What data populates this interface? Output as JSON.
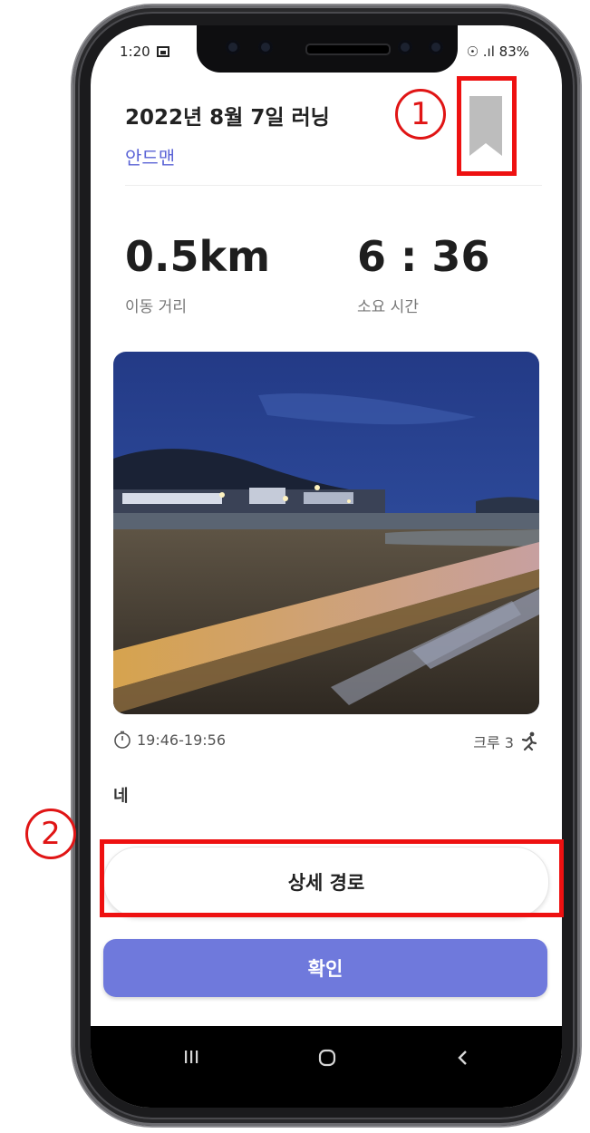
{
  "status_bar": {
    "time": "1:20",
    "right_text": "☉ .ıl 83%"
  },
  "header": {
    "title": "2022년 8월 7일 러닝",
    "author": "안드맨"
  },
  "stats": [
    {
      "value": "0.5km",
      "label": "이동 거리"
    },
    {
      "value": "6 : 36",
      "label": "소요 시간"
    }
  ],
  "meta": {
    "time_range": "19:46-19:56",
    "crew": "크루 3"
  },
  "memo": "네",
  "buttons": {
    "route": "상세 경로",
    "confirm": "확인"
  },
  "annotations": {
    "one": "1",
    "two": "2"
  },
  "colors": {
    "accent": "#5a63d6",
    "confirm_bg": "#6f79dc",
    "annotation": "#ee1111"
  }
}
